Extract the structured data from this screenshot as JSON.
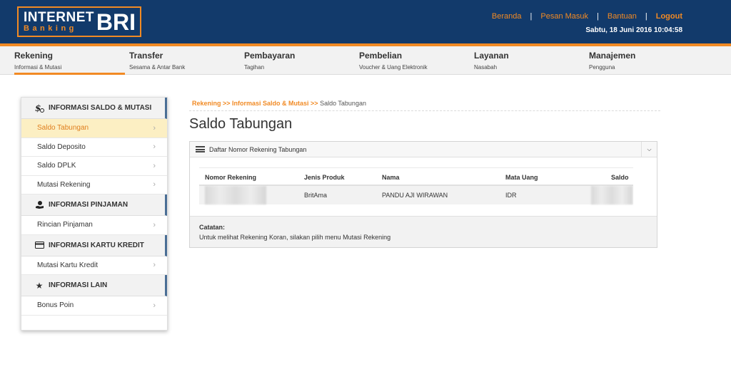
{
  "logo": {
    "line1": "INTERNET",
    "line2": "Banking",
    "brand": "BRI"
  },
  "topnav": {
    "beranda": "Beranda",
    "pesan_masuk": "Pesan Masuk",
    "bantuan": "Bantuan",
    "logout": "Logout",
    "separator": "|",
    "datetime": "Sabtu, 18 Juni 2016 10:04:58"
  },
  "menu": [
    {
      "title": "Rekening",
      "subtitle": "Informasi & Mutasi"
    },
    {
      "title": "Transfer",
      "subtitle": "Sesama & Antar Bank"
    },
    {
      "title": "Pembayaran",
      "subtitle": "Tagihan"
    },
    {
      "title": "Pembelian",
      "subtitle": "Voucher & Uang Elektronik"
    },
    {
      "title": "Layanan",
      "subtitle": "Nasabah"
    },
    {
      "title": "Manajemen",
      "subtitle": "Pengguna"
    }
  ],
  "sidebar": {
    "sections": [
      {
        "title": "INFORMASI SALDO & MUTASI",
        "icon": "money-icon",
        "items": [
          "Saldo Tabungan",
          "Saldo Deposito",
          "Saldo DPLK",
          "Mutasi Rekening"
        ]
      },
      {
        "title": "INFORMASI PINJAMAN",
        "icon": "loan-icon",
        "items": [
          "Rincian Pinjaman"
        ]
      },
      {
        "title": "INFORMASI KARTU KREDIT",
        "icon": "credit-card-icon",
        "items": [
          "Mutasi Kartu Kredit"
        ]
      },
      {
        "title": "INFORMASI LAIN",
        "icon": "star-icon",
        "items": [
          "Bonus Poin"
        ]
      }
    ]
  },
  "breadcrumb": {
    "link1": "Rekening >> Informasi Saldo & Mutasi >>",
    "current": " Saldo Tabungan"
  },
  "page_title": "Saldo Tabungan",
  "panel": {
    "header": "Daftar Nomor Rekening Tabungan",
    "columns": [
      "Nomor Rekening",
      "Jenis Produk",
      "Nama",
      "Mata Uang",
      "Saldo"
    ],
    "rows": [
      {
        "nomor_rekening": "",
        "jenis_produk": "BritAma",
        "nama": "PANDU AJI WIRAWAN",
        "mata_uang": "IDR",
        "saldo": ""
      }
    ],
    "catatan_label": "Catatan:",
    "catatan_text": "Untuk melihat Rekening Koran, silakan pilih menu Mutasi Rekening"
  },
  "colors": {
    "navy": "#123a6b",
    "orange": "#f18a24",
    "active_bg": "#fcefc3"
  }
}
